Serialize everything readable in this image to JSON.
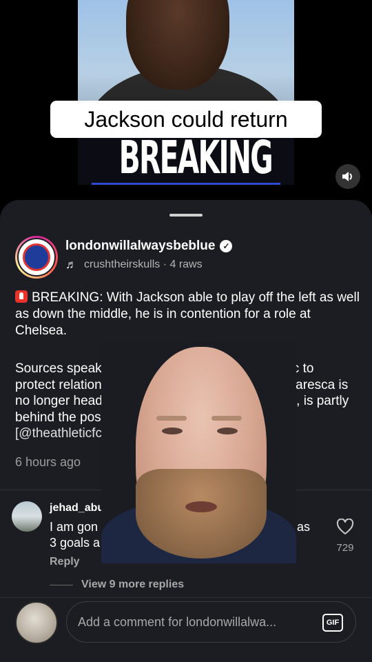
{
  "video": {
    "caption": "Jackson could return",
    "banner_text": "BREAKING",
    "sound_icon": "speaker-icon"
  },
  "post": {
    "username": "londonwillalwaysbeblue",
    "verified_icon": "verified-check-icon",
    "audio_icon": "music-note-icon",
    "audio": "crushtheirskulls · 4 raws",
    "paragraph1": "BREAKING: With Jackson able to play off the left as well as down the middle, he is in contention for a role at Chelsea.",
    "paragraph2_line1_start": "Sources speaking anon",
    "paragraph2_line1_end": "Athletic to",
    "paragraph2_line2_start": "protect relationships s",
    "paragraph2_line2_end": "zo Maresca is",
    "paragraph2_line3_start": "no longer head coach",
    "paragraph2_line3_end": "helm, is partly",
    "paragraph2_line4": "behind the possible s",
    "mention": "[@theathleticfc]",
    "time": "6 hours ago"
  },
  "comment": {
    "username": "jehad_abus6",
    "text_line1": "I am gon",
    "text_line1_end": "as",
    "text_line2": "3 goals a",
    "reply_label": "Reply",
    "like_count": "729",
    "view_more": "View 9 more replies"
  },
  "composer": {
    "placeholder": "Add a comment for londonwillalwa...",
    "gif_label": "GIF"
  }
}
